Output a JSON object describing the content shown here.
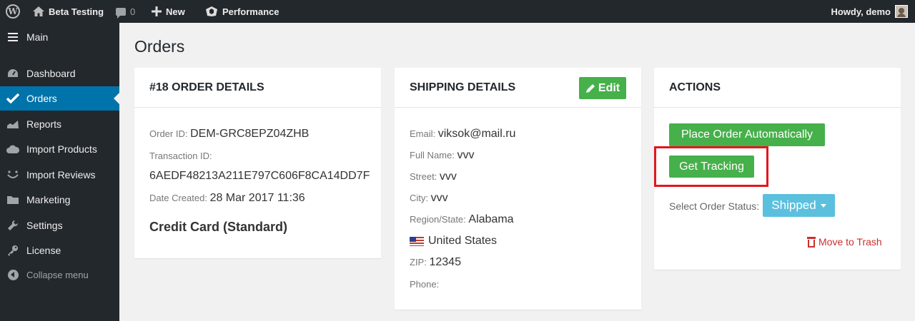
{
  "adminbar": {
    "site_name": "Beta Testing",
    "comment_count": "0",
    "new_label": "New",
    "performance_label": "Performance",
    "howdy": "Howdy, demo"
  },
  "sidebar": {
    "items": [
      {
        "label": "Main",
        "icon": "hamburger-icon"
      },
      {
        "label": "Dashboard",
        "icon": "dashboard-icon"
      },
      {
        "label": "Orders",
        "icon": "checkmark-icon",
        "active": true
      },
      {
        "label": "Reports",
        "icon": "chart-icon"
      },
      {
        "label": "Import Products",
        "icon": "cloud-icon"
      },
      {
        "label": "Import Reviews",
        "icon": "smile-icon"
      },
      {
        "label": "Marketing",
        "icon": "folder-icon"
      },
      {
        "label": "Settings",
        "icon": "wrench-icon"
      },
      {
        "label": "License",
        "icon": "key-icon"
      },
      {
        "label": "Collapse menu",
        "icon": "collapse-icon"
      }
    ]
  },
  "page": {
    "title": "Orders"
  },
  "order": {
    "heading": "#18 ORDER DETAILS",
    "order_id_label": "Order ID:",
    "order_id": "DEM-GRC8EPZ04ZHB",
    "transaction_label": "Transaction ID:",
    "transaction_id": "6AEDF48213A211E797C606F8CA14DD7F",
    "date_label": "Date Created:",
    "date": "28 Mar 2017 11:36",
    "payment": "Credit Card (Standard)"
  },
  "shipping": {
    "heading": "SHIPPING DETAILS",
    "edit_label": "Edit",
    "email_label": "Email:",
    "email": "viksok@mail.ru",
    "name_label": "Full Name:",
    "name": "vvv",
    "street_label": "Street:",
    "street": "vvv",
    "city_label": "City:",
    "city": "vvv",
    "region_label": "Region/State:",
    "region": "Alabama",
    "country": "United States",
    "zip_label": "ZIP:",
    "zip": "12345",
    "phone_label": "Phone:"
  },
  "actions": {
    "heading": "ACTIONS",
    "place_order_label": "Place Order Automatically",
    "get_tracking_label": "Get Tracking",
    "status_label": "Select Order Status:",
    "status_value": "Shipped",
    "trash_label": "Move to Trash"
  },
  "colors": {
    "adminbar_bg": "#23282d",
    "active_menu": "#0073aa",
    "button_green": "#46b04a",
    "status_blue": "#5bc0de",
    "highlight_red": "#e3161e",
    "trash_red": "#c9302c"
  }
}
